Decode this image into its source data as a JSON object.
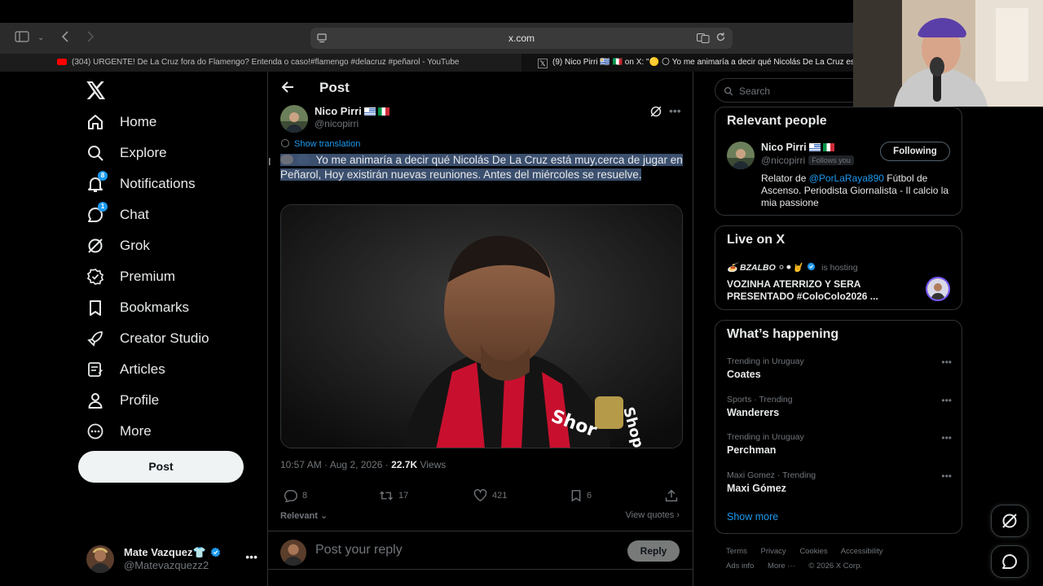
{
  "browser": {
    "url": "x.com",
    "tabs": [
      {
        "title": "(304) URGENTE! De La Cruz fora do Flamengo? Entenda o caso!#flamengo #delacruz #peñarol - YouTube"
      },
      {
        "title": "(9) Nico Pirri 🇺🇾 🇮🇹 on X: \"🟡 🌕 Yo me animaría a decir qué Nicolás De La Cruz es..."
      }
    ]
  },
  "nav": {
    "items": [
      {
        "label": "Home",
        "icon": "home-icon"
      },
      {
        "label": "Explore",
        "icon": "search-icon"
      },
      {
        "label": "Notifications",
        "icon": "bell-icon",
        "badge": "8"
      },
      {
        "label": "Chat",
        "icon": "chat-icon",
        "badge": "1"
      },
      {
        "label": "Grok",
        "icon": "grok-icon"
      },
      {
        "label": "Premium",
        "icon": "premium-icon"
      },
      {
        "label": "Bookmarks",
        "icon": "bookmark-icon"
      },
      {
        "label": "Creator Studio",
        "icon": "rocket-icon"
      },
      {
        "label": "Articles",
        "icon": "articles-icon"
      },
      {
        "label": "Profile",
        "icon": "person-icon"
      },
      {
        "label": "More",
        "icon": "more-circle-icon"
      }
    ],
    "post_button": "Post",
    "account": {
      "name": "Mate Vazquez👕",
      "handle": "@Matevazquezz2"
    }
  },
  "main": {
    "title": "Post",
    "author": {
      "name": "Nico Pirri",
      "handle": "@nicopirri"
    },
    "show_translation": "Show translation",
    "text": "Yo me animaría a decir qué Nicolás De La Cruz está muy,cerca de jugar en Peñarol, Hoy existirán nuevas reuniones. Antes del miércoles se resuelve.",
    "meta": {
      "time": "10:57 AM · Aug 2, 2026 · ",
      "views_count": "22.7K",
      "views_label": " Views"
    },
    "actions": {
      "replies": "8",
      "reposts": "17",
      "likes": "421",
      "bookmarks": "6"
    },
    "relevant": "Relevant",
    "view_quotes": "View quotes",
    "reply_placeholder": "Post your reply",
    "reply_button": "Reply"
  },
  "sidebar": {
    "search_placeholder": "Search",
    "relevant_people": {
      "title": "Relevant people",
      "name": "Nico Pirri",
      "handle": "@nicopirri",
      "follows_you": "Follows you",
      "button": "Following",
      "bio_prefix": "Relator de ",
      "bio_mention": "@PorLaRaya890",
      "bio_suffix": " Fútbol de Ascenso. Periodista Giornalista - Il calcio la mia passione"
    },
    "live": {
      "title": "Live on X",
      "host": "🍝 BZALBO ⚪⚫🤘",
      "hosting": "is hosting",
      "stream_title": "VOZINHA ATERRIZO Y SERA PRESENTADO #ColoColo2026 ..."
    },
    "happening": {
      "title": "What’s happening",
      "trends": [
        {
          "category": "Trending in Uruguay",
          "name": "Coates"
        },
        {
          "category": "Sports · Trending",
          "name": "Wanderers"
        },
        {
          "category": "Trending in Uruguay",
          "name": "Perchman"
        },
        {
          "category": "Maxi Gomez · Trending",
          "name": "Maxi Gómez"
        }
      ],
      "show_more": "Show more"
    },
    "footer": {
      "links1": [
        "Terms",
        "Privacy",
        "Cookies",
        "Accessibility"
      ],
      "links2": [
        "Ads info",
        "More ···",
        "© 2026 X Corp."
      ]
    }
  },
  "colors": {
    "accent": "#1d9bf0",
    "background": "#000000",
    "border": "#2f3336"
  }
}
